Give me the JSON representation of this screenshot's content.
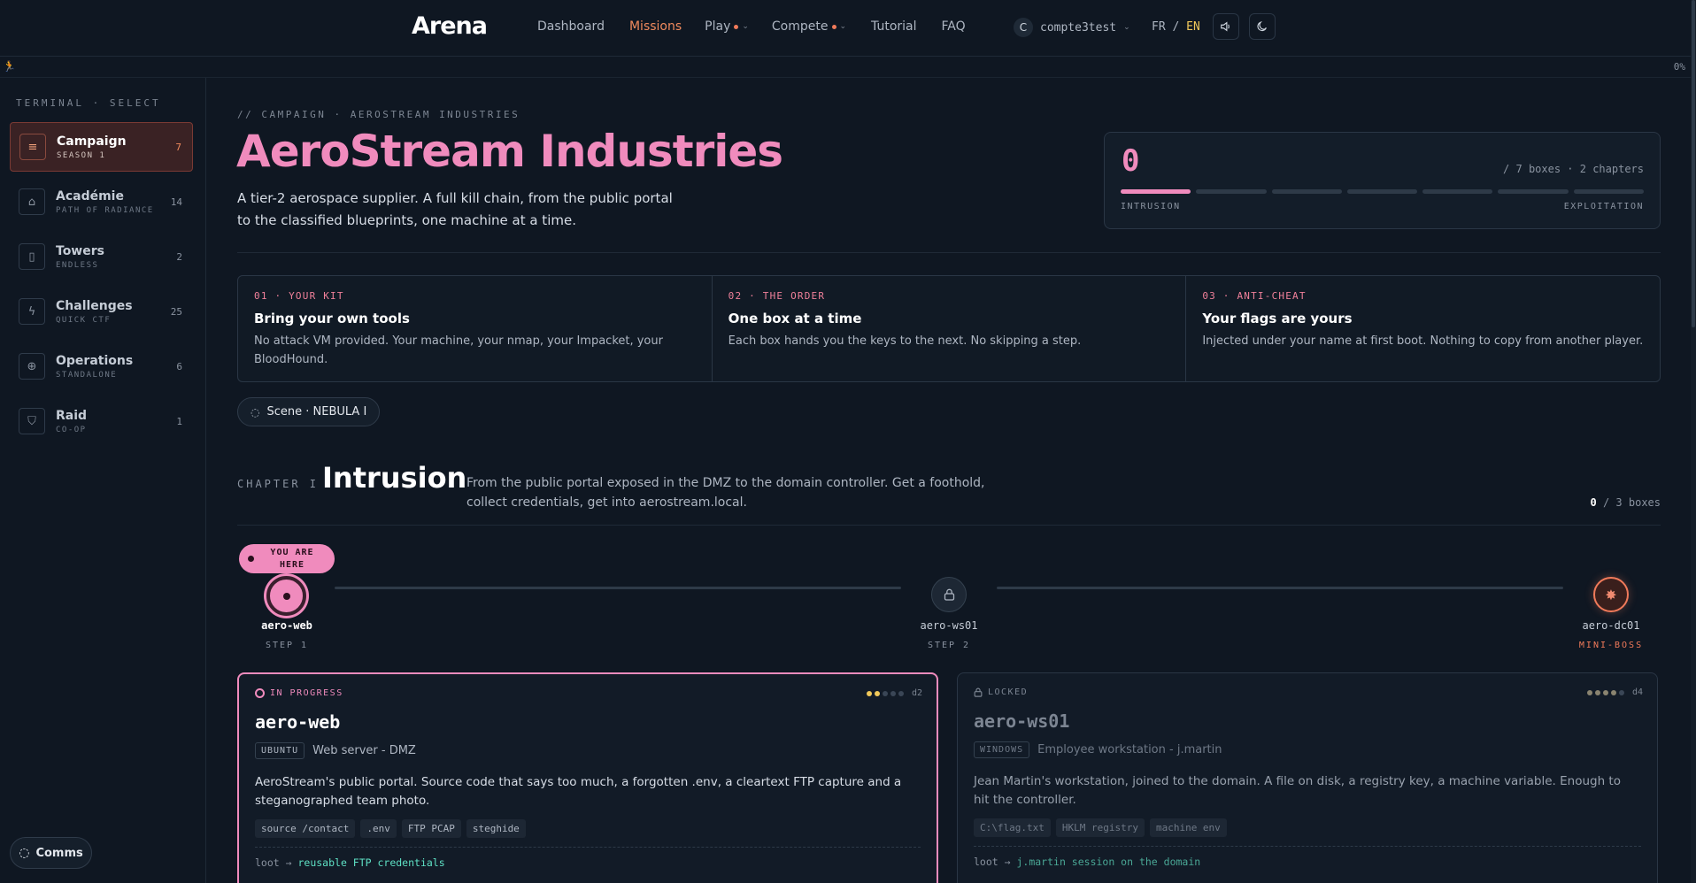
{
  "nav": {
    "logo": "Arena",
    "links": [
      {
        "label": "Dashboard"
      },
      {
        "label": "Missions"
      },
      {
        "label": "Play"
      },
      {
        "label": "Compete"
      },
      {
        "label": "Tutorial"
      },
      {
        "label": "FAQ"
      }
    ],
    "user_initial": "C",
    "username": "compte3test",
    "lang_fr": "FR",
    "lang_sep": "/",
    "lang_en": "EN",
    "progress_pct": "0%"
  },
  "sidebar": {
    "title": "TERMINAL · SELECT",
    "items": [
      {
        "label": "Campaign",
        "sub": "SEASON 1",
        "count": "7",
        "icon": "list-icon"
      },
      {
        "label": "Académie",
        "sub": "PATH OF RADIANCE",
        "count": "14",
        "icon": "graduation-cap-icon"
      },
      {
        "label": "Towers",
        "sub": "ENDLESS",
        "count": "2",
        "icon": "tower-icon"
      },
      {
        "label": "Challenges",
        "sub": "QUICK CTF",
        "count": "25",
        "icon": "bolt-icon"
      },
      {
        "label": "Operations",
        "sub": "STANDALONE",
        "count": "6",
        "icon": "crosshair-icon"
      },
      {
        "label": "Raid",
        "sub": "CO-OP",
        "count": "1",
        "icon": "shield-icon"
      }
    ],
    "comms": "Comms"
  },
  "campaign": {
    "crumb": "// CAMPAIGN · AEROSTREAM INDUSTRIES",
    "title": "AeroStream Industries",
    "description": "A tier-2 aerospace supplier. A full kill chain, from the public portal to the classified blueprints, one machine at a time.",
    "stat_value": "0",
    "stat_meta": "/ 7 boxes · 2 chapters",
    "stat_left": "INTRUSION",
    "stat_right": "EXPLOITATION",
    "stat_progress_fraction": 0.14
  },
  "rules": [
    {
      "kicker": "01 · YOUR KIT",
      "heading": "Bring your own tools",
      "text": "No attack VM provided. Your machine, your nmap, your Impacket, your BloodHound."
    },
    {
      "kicker": "02 · THE ORDER",
      "heading": "One box at a time",
      "text": "Each box hands you the keys to the next. No skipping a step."
    },
    {
      "kicker": "03 · ANTI-CHEAT",
      "heading": "Your flags are yours",
      "text": "Injected under your name at first boot. Nothing to copy from another player."
    }
  ],
  "scene": "Scene · NEBULA I",
  "chapter": {
    "kicker": "CHAPTER I",
    "title": "Intrusion",
    "description": "From the public portal exposed in the DMZ to the domain controller. Get a foothold, collect credentials, get into aerostream.local.",
    "done": "0",
    "total": "/ 3 boxes"
  },
  "path": {
    "here_label": "YOU ARE HERE",
    "nodes": [
      {
        "name": "aero-web",
        "step": "STEP 1"
      },
      {
        "name": "aero-ws01",
        "step": "STEP 2"
      },
      {
        "name": "aero-dc01",
        "step": "MINI-BOSS"
      }
    ]
  },
  "boxes": [
    {
      "status": "IN PROGRESS",
      "difficulty": "d2",
      "difficulty_level": 2,
      "name": "aero-web",
      "os": "UBUNTU",
      "role": "Web server - DMZ",
      "description": "AeroStream's public portal. Source code that says too much, a forgotten .env, a cleartext FTP capture and a steganographed team photo.",
      "tags": [
        "source /contact",
        ".env",
        "FTP PCAP",
        "steghide"
      ],
      "loot_prefix": "loot →",
      "loot": "reusable FTP credentials"
    },
    {
      "status": "LOCKED",
      "difficulty": "d4",
      "difficulty_level": 4,
      "name": "aero-ws01",
      "os": "WINDOWS",
      "role": "Employee workstation - j.martin",
      "description": "Jean Martin's workstation, joined to the domain. A file on disk, a registry key, a machine variable. Enough to hit the controller.",
      "tags": [
        "C:\\flag.txt",
        "HKLM registry",
        "machine env"
      ],
      "loot_prefix": "loot →",
      "loot": "j.martin session on the domain"
    }
  ]
}
